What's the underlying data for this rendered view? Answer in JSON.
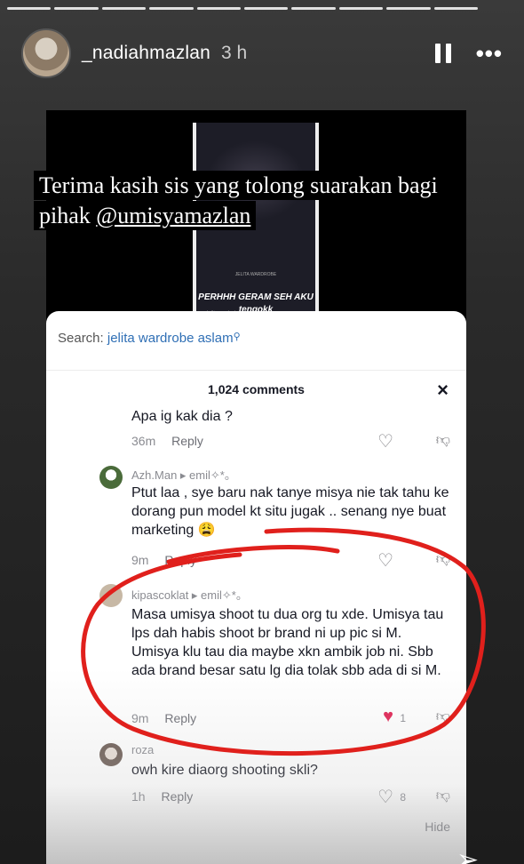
{
  "story": {
    "progress_segments": 10,
    "username": "_nadiahmazlan",
    "time": "3 h",
    "more_label": "•••"
  },
  "video": {
    "small_text": "JELITA WARDROBE",
    "overlay_text_1": "PERHHH GERAM SEH AKU",
    "overlay_text_2": "tengokk",
    "tag": "jelitawardrobe"
  },
  "caption": {
    "line_1": "Terima kasih sis yang tolong suarakan bagi",
    "line_2_prefix": "pihak ",
    "mention": "@umisyamazlan"
  },
  "card": {
    "search_label": "Search:",
    "search_query": "jelita wardrobe aslam",
    "comments_count": "1,024 comments",
    "close_icon": "×",
    "hide_label": "Hide",
    "comments": [
      {
        "name": "",
        "text": "Apa ig kak dia ?",
        "time": "36m",
        "reply": "Reply",
        "likes": ""
      },
      {
        "name": "Azh.Man ▸ emil✧*。",
        "text": "Ptut laa , sye baru nak tanye misya nie tak tahu ke dorang pun model kt situ jugak .. senang nye buat marketing 😩",
        "time": "9m",
        "reply": "Reply",
        "likes": ""
      },
      {
        "name": "kipascoklat ▸ emil✧*。",
        "text": "Masa umisya shoot tu dua org tu xde. Umisya tau lps dah habis shoot br brand ni up pic si M. Umisya klu tau dia maybe xkn ambik job ni. Sbb ada brand besar satu lg dia tolak sbb ada di si M.",
        "time": "9m",
        "reply": "Reply",
        "likes": "1"
      },
      {
        "name": "roza",
        "text": "owh kire diaorg shooting skli?",
        "time": "1h",
        "reply": "Reply",
        "likes": "8"
      }
    ]
  },
  "colors": {
    "annotation": "#e0201c",
    "link": "#2f6fb5",
    "liked": "#e02454"
  }
}
